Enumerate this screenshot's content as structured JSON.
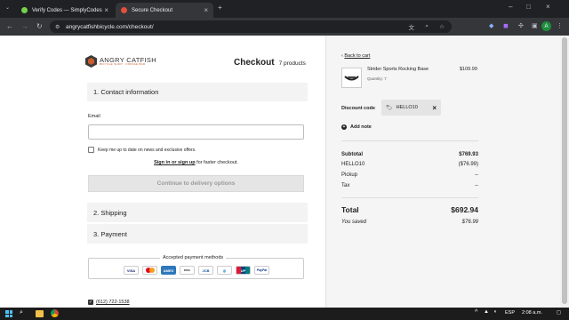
{
  "browser": {
    "tabs": [
      {
        "title": "Verify Codes — SimplyCodes",
        "active": false,
        "favicon_color": "#74d14c"
      },
      {
        "title": "Secure Checkout",
        "active": true,
        "favicon_color": "#e0503c"
      }
    ],
    "url": "angrycatfishbicycle.com/checkout/",
    "profile_initial": "A"
  },
  "brand": {
    "name": "ANGRY CATFISH",
    "tagline": "BICYCLE SHOP · COFFEE BAR"
  },
  "checkout": {
    "title": "Checkout",
    "product_count": "7 products",
    "contact_section": "1. Contact information",
    "email_label": "Email",
    "email_value": "",
    "newsletter_label": "Keep me up to date on news and exclusive offers.",
    "sign_in_link": "Sign in or sign up",
    "sign_in_suffix": " for faster checkout.",
    "continue_button": "Continue to delivery options",
    "shipping_section": "2. Shipping",
    "payment_section": "3. Payment",
    "payment_methods_title": "Accepted payment methods",
    "payment_methods": [
      "VISA",
      "MC",
      "AMEX",
      "DISCOVER",
      "JCB",
      "DINERS",
      "UNIONPAY",
      "PayPal"
    ],
    "phone": "(612) 722-1538"
  },
  "cart": {
    "back_link": "Back to cart",
    "item": {
      "name": "Strider Sports Rocking Base",
      "quantity": "Quantity: 7",
      "price": "$109.99"
    },
    "discount_label": "Discount code",
    "discount_code": "HELLO10",
    "add_note": "Add note",
    "subtotal_label": "Subtotal",
    "subtotal_value": "$769.93",
    "discount_line_label": "HELLO10",
    "discount_line_value": "($76.99)",
    "pickup_label": "Pickup",
    "pickup_value": "--",
    "tax_label": "Tax",
    "tax_value": "--",
    "total_label": "Total",
    "total_value": "$692.94",
    "saved_label": "You saved",
    "saved_value": "$76.99"
  },
  "taskbar": {
    "lang": "ESP",
    "time": "2:08 a.m."
  },
  "colors": {
    "tab_bg": "#202124",
    "toolbar": "#35363a",
    "section_bg": "#f3f3f3",
    "panel_bg": "#f5f5f5"
  }
}
